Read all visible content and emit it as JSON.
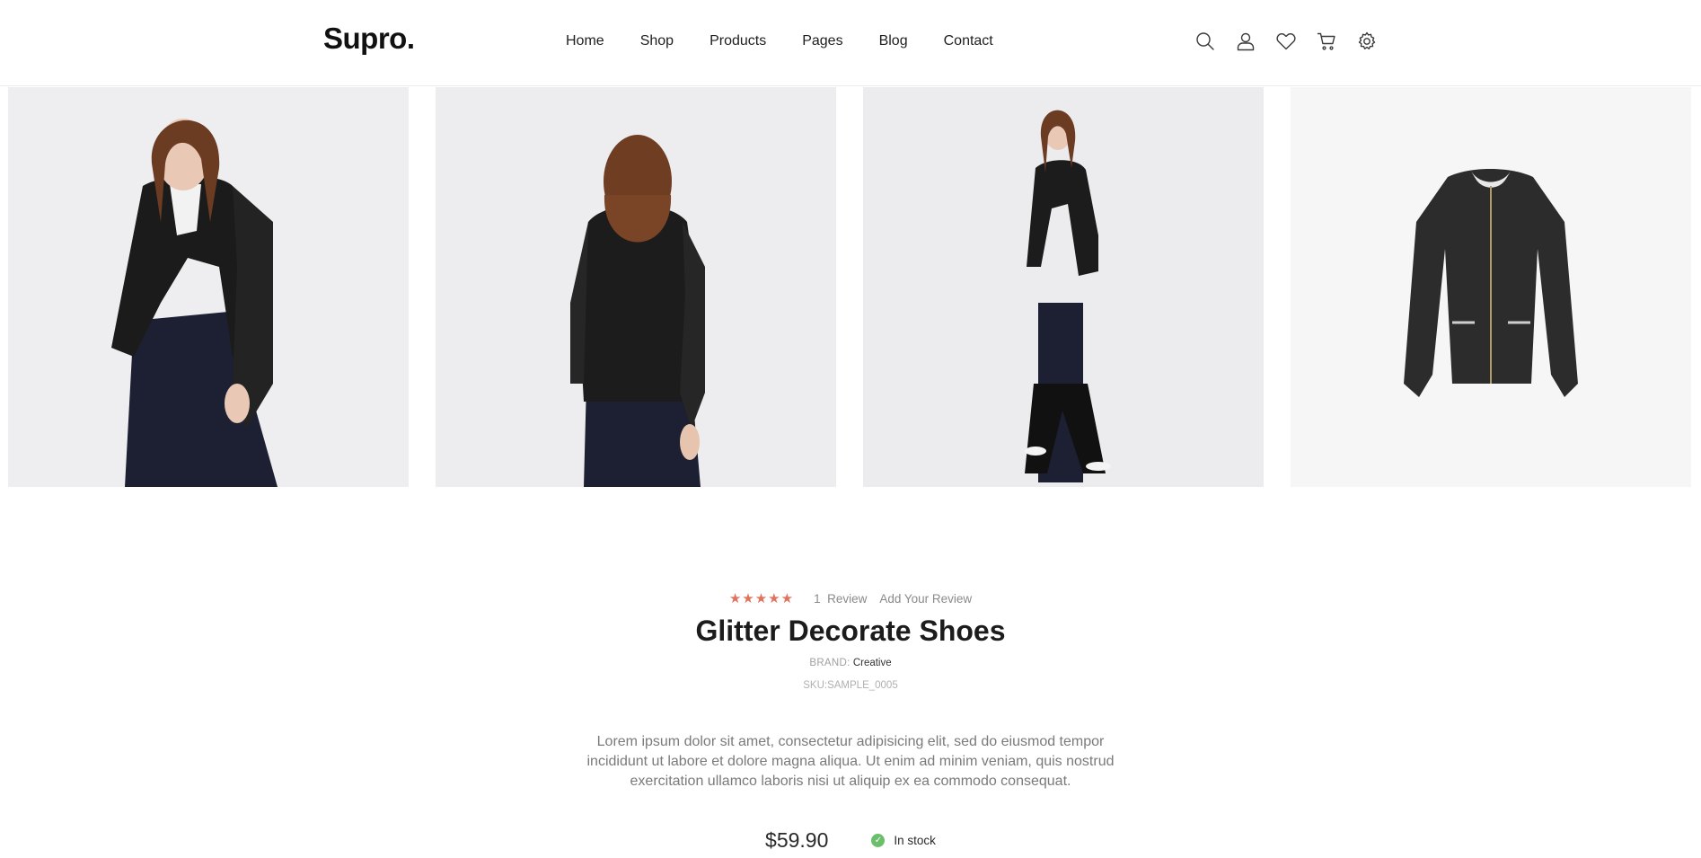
{
  "header": {
    "logo": "Supro.",
    "nav": [
      {
        "label": "Home"
      },
      {
        "label": "Shop"
      },
      {
        "label": "Products"
      },
      {
        "label": "Pages"
      },
      {
        "label": "Blog"
      },
      {
        "label": "Contact"
      }
    ],
    "icons": [
      "search-icon",
      "user-icon",
      "heart-icon",
      "cart-icon",
      "settings-icon"
    ]
  },
  "gallery": {
    "images": [
      {
        "subject": "model-front-leather-jacket"
      },
      {
        "subject": "model-back-leather-jacket"
      },
      {
        "subject": "model-full-body-leather-jacket"
      },
      {
        "subject": "leather-jacket-product"
      }
    ]
  },
  "product": {
    "stars": "★★★★★",
    "rating_value": 5,
    "review_count": "1",
    "review_label": "Review",
    "add_review": "Add Your Review",
    "title": "Glitter Decorate Shoes",
    "brand_label": "BRAND:",
    "brand_value": "Creative",
    "sku": "SKU:SAMPLE_0005",
    "description": "Lorem ipsum dolor sit amet, consectetur adipisicing elit, sed do eiusmod tempor incididunt ut labore et dolore magna aliqua. Ut enim ad minim veniam, quis nostrud exercitation ullamco laboris nisi ut aliquip ex ea commodo consequat.",
    "price": "$59.90",
    "stock": "In stock"
  },
  "colors": {
    "star": "#e0735e",
    "in_stock": "#6cbf6a",
    "text": "#1f1f1f",
    "muted": "#7a7a7a"
  }
}
